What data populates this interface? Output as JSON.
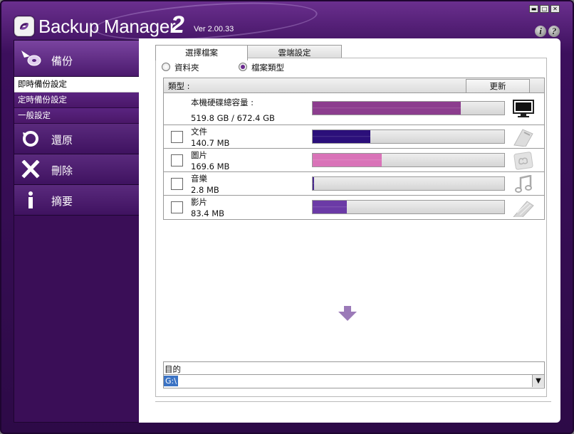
{
  "window": {
    "app_name": "Backup Manager",
    "app_name_number": "2",
    "version": "Ver 2.00.33",
    "controls": [
      "minimize-icon",
      "maximize-icon",
      "close-icon"
    ],
    "help": [
      "info-icon",
      "help-icon"
    ]
  },
  "sidebar": {
    "backup": {
      "label": "備份",
      "icon": "backup-disc-icon"
    },
    "backup_sub": [
      "即時備份設定",
      "定時備份設定",
      "一般設定"
    ],
    "active_sub": 0,
    "restore": {
      "label": "還原",
      "icon": "restore-icon"
    },
    "delete": {
      "label": "刪除",
      "icon": "delete-x-icon"
    },
    "summary": {
      "label": "摘要",
      "icon": "info-i-icon"
    }
  },
  "tabs": [
    "選擇檔案",
    "雲端設定"
  ],
  "active_tab": 0,
  "mode": {
    "folder": "資料夾",
    "file_type": "檔案類型",
    "selected": "file_type"
  },
  "list": {
    "header_type": "類型 :",
    "refresh": "更新",
    "disk": {
      "title": "本機硬碟總容量 :",
      "usage": "519.8 GB / 672.4 GB",
      "fill_fraction": 0.773,
      "color": "#8c3d8e",
      "icon": "monitor-icon"
    },
    "rows": [
      {
        "name": "文件",
        "size": "140.7 MB",
        "fill_fraction": 0.3,
        "color": "#2b0f7a",
        "icon": "document-icon",
        "checked": false
      },
      {
        "name": "圖片",
        "size": "169.6 MB",
        "fill_fraction": 0.36,
        "color": "#d973b8",
        "icon": "picture-icon",
        "checked": false
      },
      {
        "name": "音樂",
        "size": "2.8 MB",
        "fill_fraction": 0.006,
        "color": "#4a2a8e",
        "icon": "music-note-icon",
        "checked": false
      },
      {
        "name": "影片",
        "size": "83.4 MB",
        "fill_fraction": 0.18,
        "color": "#6b3aa6",
        "icon": "film-icon",
        "checked": false
      }
    ]
  },
  "destination": {
    "label": "目的",
    "value": "G:\\"
  },
  "colors": {
    "accent": "#5a2480",
    "sidebar_bg": "#3a0e57",
    "selection": "#3b73c4"
  }
}
